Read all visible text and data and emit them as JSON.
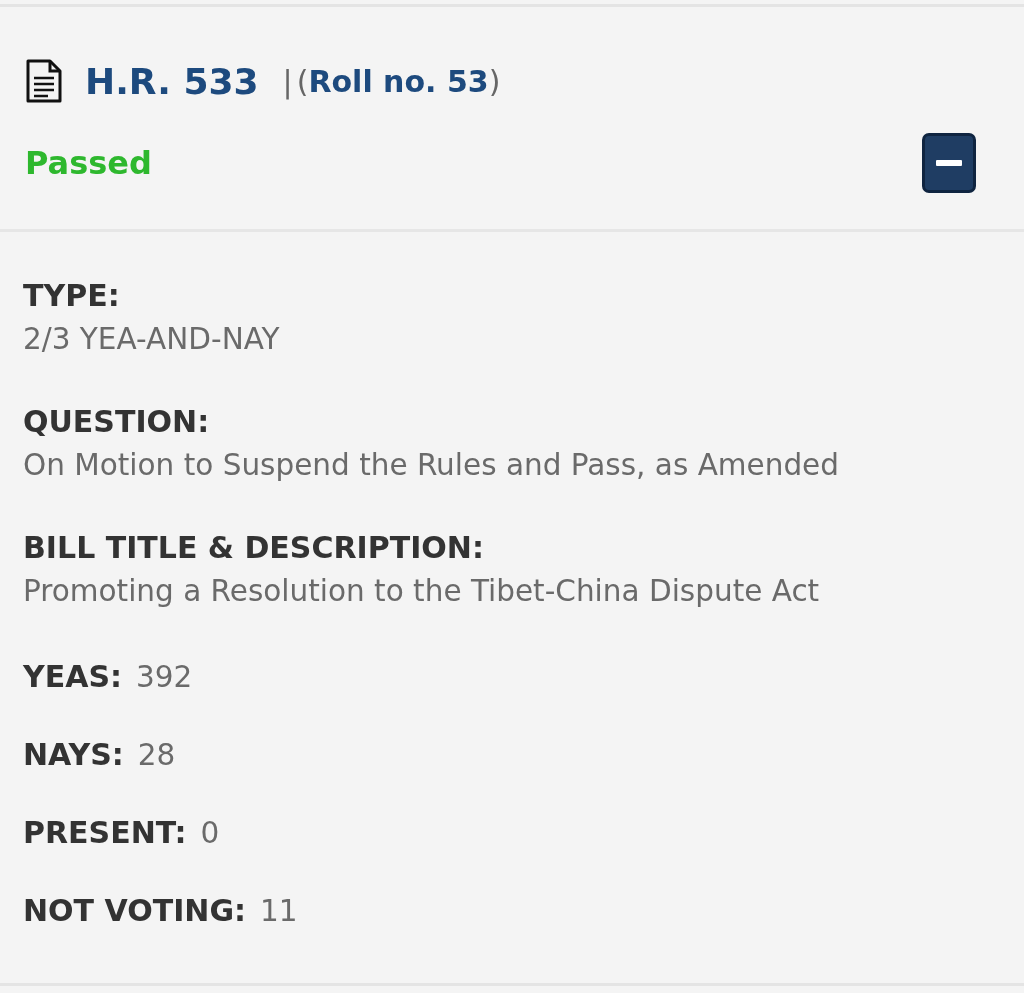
{
  "bill": {
    "number": "H.R. 533",
    "separator": "|",
    "roll_open": "(",
    "roll": "Roll no. 53",
    "roll_close": ")",
    "status": "Passed",
    "expanded": true
  },
  "fields": [
    {
      "kind": "block",
      "label": "TYPE:",
      "value": "2/3 YEA-AND-NAY"
    },
    {
      "kind": "block",
      "label": "QUESTION:",
      "value": "On Motion to Suspend the Rules and Pass, as Amended"
    },
    {
      "kind": "block",
      "label": "BILL TITLE & DESCRIPTION:",
      "value": "Promoting a Resolution to the Tibet-China Dispute Act"
    },
    {
      "kind": "inline",
      "label": "YEAS:",
      "value": "392"
    },
    {
      "kind": "inline",
      "label": "NAYS:",
      "value": "28"
    },
    {
      "kind": "inline",
      "label": "PRESENT:",
      "value": "0"
    },
    {
      "kind": "inline",
      "label": "NOT VOTING:",
      "value": "11"
    }
  ]
}
